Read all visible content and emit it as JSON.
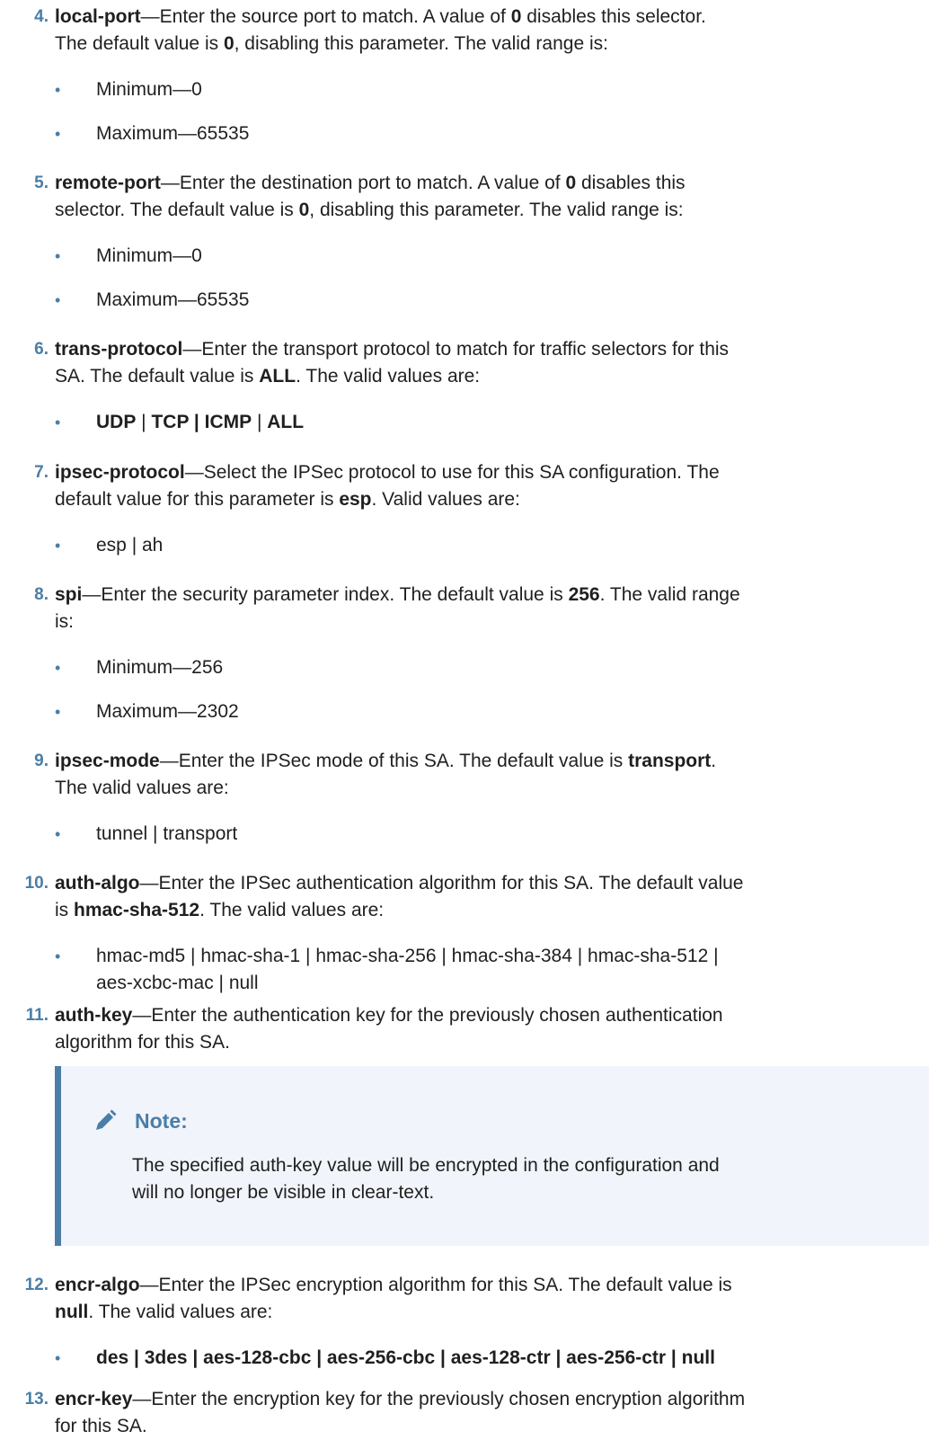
{
  "steps": [
    {
      "number": "4.",
      "term": "local-port",
      "line1": [
        "—Enter the source port to match. A value of ",
        "0",
        " disables this selector."
      ],
      "line2": [
        "The default value is ",
        "0",
        ", disabling this parameter. The valid range is:"
      ],
      "bullets": [
        "Minimum—0",
        "Maximum—65535"
      ]
    },
    {
      "number": "5.",
      "term": "remote-port",
      "line1": [
        "—Enter the destination port to match. A value of ",
        "0",
        " disables this"
      ],
      "line2": [
        "selector. The default value is ",
        "0",
        ", disabling this parameter. The valid range is:"
      ],
      "bullets": [
        "Minimum—0",
        "Maximum—65535"
      ]
    },
    {
      "number": "6.",
      "term": "trans-protocol",
      "line1": [
        "—Enter the transport protocol to match for traffic selectors for this"
      ],
      "line2": [
        "SA. The default value is ",
        "ALL",
        ". The valid values are:"
      ],
      "bullets_bold": [
        "UDP",
        " | ",
        "TCP | ICMP",
        " | ",
        "ALL"
      ]
    },
    {
      "number": "7.",
      "term": "ipsec-protocol",
      "line1": [
        "—Select the IPSec protocol to use for this SA configuration. The"
      ],
      "line2": [
        "default value for this parameter is ",
        "esp",
        ". Valid values are:"
      ],
      "bullets": [
        "esp | ah"
      ]
    },
    {
      "number": "8.",
      "term": "spi",
      "line1": [
        "—Enter the security parameter index. The default value is ",
        "256",
        ". The valid range"
      ],
      "line2": [
        "is:"
      ],
      "bullets": [
        "Minimum—256",
        "Maximum—2302"
      ]
    },
    {
      "number": "9.",
      "term": "ipsec-mode",
      "line1": [
        "—Enter the IPSec mode of this SA. The default value is ",
        "transport",
        "."
      ],
      "line2": [
        "The valid values are:"
      ],
      "bullets": [
        "tunnel | transport"
      ]
    },
    {
      "number": "10.",
      "term": "auth-algo",
      "line1": [
        "—Enter the IPSec authentication algorithm for this SA. The default value"
      ],
      "line2": [
        "is ",
        "hmac-sha-512",
        ". The valid values are:"
      ],
      "bullets": [
        "hmac-md5 | hmac-sha-1 | hmac-sha-256 | hmac-sha-384 | hmac-sha-512 |",
        "aes-xcbc-mac | null"
      ]
    },
    {
      "number": "11.",
      "term": "auth-key",
      "line1": [
        "—Enter the authentication key for the previously chosen authentication"
      ],
      "line2": [
        "algorithm for this SA."
      ]
    },
    {
      "number": "12.",
      "term": "encr-algo",
      "line1": [
        "—Enter the IPSec encryption algorithm for this SA. The default value is"
      ],
      "line2": [
        "null",
        ". The valid values are:"
      ],
      "bullets_bold_single": "des | 3des | aes-128-cbc | aes-256-cbc | aes-128-ctr | aes-256-ctr | null"
    },
    {
      "number": "13.",
      "term": "encr-key",
      "line1": [
        "—Enter the encryption key for the previously chosen encryption algorithm"
      ],
      "line2": [
        "for this SA."
      ]
    }
  ],
  "note": {
    "icon": "pencil-icon",
    "title": "Note:",
    "line1": "The specified auth-key value will be encrypted in the configuration and",
    "line2": "will no longer be visible in clear-text."
  },
  "colors": {
    "accent": "#4a7ea7",
    "note_background": "#f1f4fa",
    "text": "#1f1f1f"
  }
}
